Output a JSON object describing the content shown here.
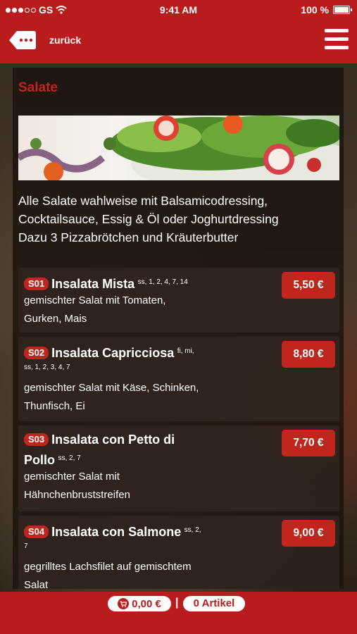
{
  "status_bar": {
    "carrier": "GS",
    "time": "9:41 AM",
    "battery": "100 %",
    "icons": [
      "signal-dots-icon",
      "wifi-icon",
      "battery-icon"
    ]
  },
  "nav": {
    "back_label": "zurück",
    "icons": [
      "back-tag-icon",
      "menu-icon"
    ]
  },
  "section": {
    "title": "Salate",
    "intro_lines": [
      "Alle Salate wahlweise mit Balsamicodressing,",
      "Cocktailsauce, Essig & Öl oder Joghurtdressing",
      "Dazu 3 Pizzabrötchen und Kräuterbutter"
    ]
  },
  "items": [
    {
      "code": "S01",
      "name": "Insalata Mista",
      "allergens": "ss, 1, 2, 4, 7, 14",
      "desc_lines": [
        "gemischter Salat mit Tomaten,",
        "Gurken, Mais"
      ],
      "price": "5,50 €"
    },
    {
      "code": "S02",
      "name": "Insalata Capricciosa",
      "allergens": "fi, mi,",
      "allergens2": "ss, 1, 2, 3, 4, 7",
      "desc_lines": [
        "gemischter Salat mit Käse, Schinken,",
        "Thunfisch, Ei"
      ],
      "price": "8,80 €"
    },
    {
      "code": "S03",
      "name": "Insalata con Petto di",
      "name2": "Pollo",
      "allergens": "ss, 2, 7",
      "desc_lines": [
        "gemischter Salat mit",
        "Hähnchenbruststreifen"
      ],
      "price": "7,70 €"
    },
    {
      "code": "S04",
      "name": "Insalata con Salmone",
      "allergens": "ss, 2,",
      "allergens2": "7",
      "desc_lines": [
        "gegrilltes Lachsfilet auf gemischtem",
        "Salat"
      ],
      "price": "9,00 €"
    }
  ],
  "cart": {
    "total": "0,00 €",
    "separator": "|",
    "articles": "0 Artikel",
    "icon": "cart-icon"
  },
  "colors": {
    "brand_red": "#b91c1c",
    "accent_red": "#c0261e"
  }
}
